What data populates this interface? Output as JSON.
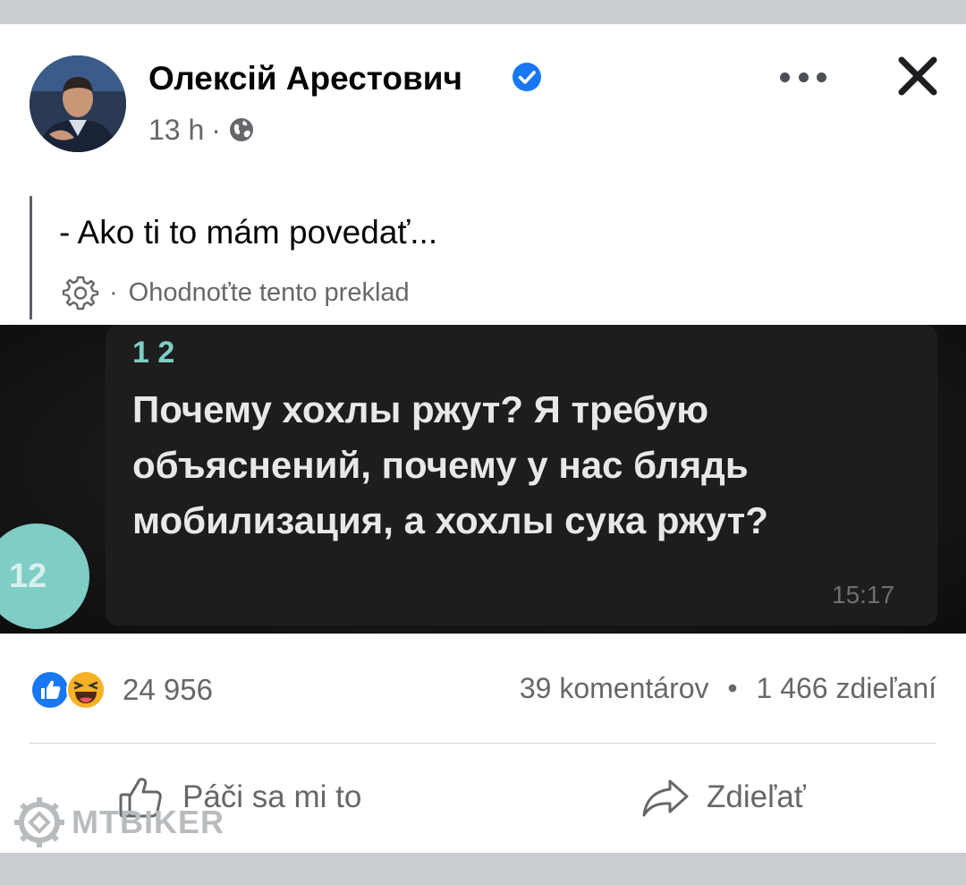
{
  "post": {
    "author": "Олексій Арестович",
    "time": "13 h",
    "meta_separator": "·",
    "text": "- Ako ti to mám povedať...",
    "rate_separator": "·",
    "rate_translation": "Ohodnoťte tento preklad"
  },
  "image": {
    "sender": "1 2",
    "message": "Почему хохлы ржут? Я требую объяснений, почему у нас блядь мобилизация, а хохлы сука ржут?",
    "avatar_label": "12",
    "time": "15:17"
  },
  "engagement": {
    "reaction_count": "24 956",
    "comments": "39 komentárov",
    "separator": "•",
    "shares": "1 466 zdieľaní"
  },
  "actions": {
    "like": "Páči sa mi to",
    "share": "Zdieľať"
  },
  "watermark": "MTBIKER",
  "colors": {
    "facebook_blue": "#1877f2",
    "secondary_text": "#65676b",
    "telegram_accent": "#7fcdc5",
    "haha_yellow": "#f7b125"
  },
  "icons": [
    "verified-badge-icon",
    "globe-icon",
    "more-options-icon",
    "close-icon",
    "gear-icon",
    "like-reaction-icon",
    "haha-reaction-icon",
    "thumbs-up-icon",
    "share-arrow-icon",
    "mtbiker-logo-icon"
  ]
}
